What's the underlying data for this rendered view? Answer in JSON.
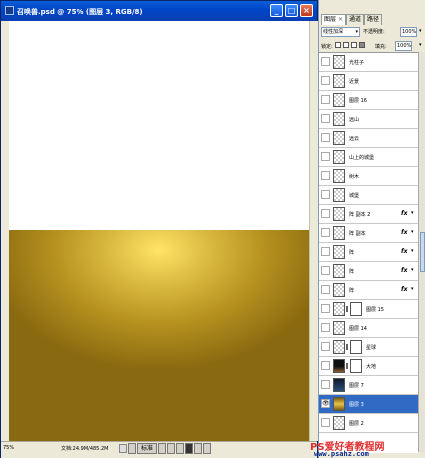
{
  "document": {
    "title": "召唤兽.psd @ 75% (图层 3, RGB/8)",
    "window_buttons": {
      "minimize": "_",
      "maximize": "□",
      "close": "×"
    },
    "status": {
      "zoom": "75%",
      "doc_info": "文档:24.9M/485.2M",
      "brand_text": "标准"
    }
  },
  "panel": {
    "tabs": [
      {
        "label": "图层",
        "active": true,
        "close": "×"
      },
      {
        "label": "通道",
        "active": false
      },
      {
        "label": "路径",
        "active": false
      }
    ],
    "blend_mode": "线性加深",
    "opacity_label": "不透明度:",
    "opacity_value": "100%",
    "lock_label": "锁定:",
    "fill_label": "填充:",
    "fill_value": "100%",
    "layers": [
      {
        "name": "光柱子",
        "fx": false
      },
      {
        "name": "近景",
        "fx": false
      },
      {
        "name": "图层 16",
        "fx": false
      },
      {
        "name": "远山",
        "fx": false
      },
      {
        "name": "远云",
        "fx": false
      },
      {
        "name": "山上的城堡",
        "fx": false
      },
      {
        "name": "树木",
        "fx": false
      },
      {
        "name": "城堡",
        "fx": false
      },
      {
        "name": "阵 副本 2",
        "fx": true
      },
      {
        "name": "阵 副本",
        "fx": true
      },
      {
        "name": "阵",
        "fx": true
      },
      {
        "name": "阵",
        "fx": true
      },
      {
        "name": "阵",
        "fx": true
      },
      {
        "name": "图层 15",
        "fx": false
      },
      {
        "name": "图层 14",
        "fx": false
      },
      {
        "name": "星球",
        "fx": false
      },
      {
        "name": "大地",
        "fx": false
      },
      {
        "name": "图层 7",
        "fx": false
      },
      {
        "name": "图层 3",
        "fx": false,
        "selected": true
      },
      {
        "name": "图层 2",
        "fx": false
      }
    ],
    "fx_symbol": "fx",
    "caret": "▾"
  },
  "watermark": {
    "line1": "PS爱好者教程网",
    "line2": "www.psahz.com"
  },
  "colors": {
    "titlebar": "#0046c8",
    "selected_layer": "#316ac5",
    "gold_light": "#ffe566",
    "gold_dark": "#8a6a10",
    "watermark_red": "#e03030"
  }
}
